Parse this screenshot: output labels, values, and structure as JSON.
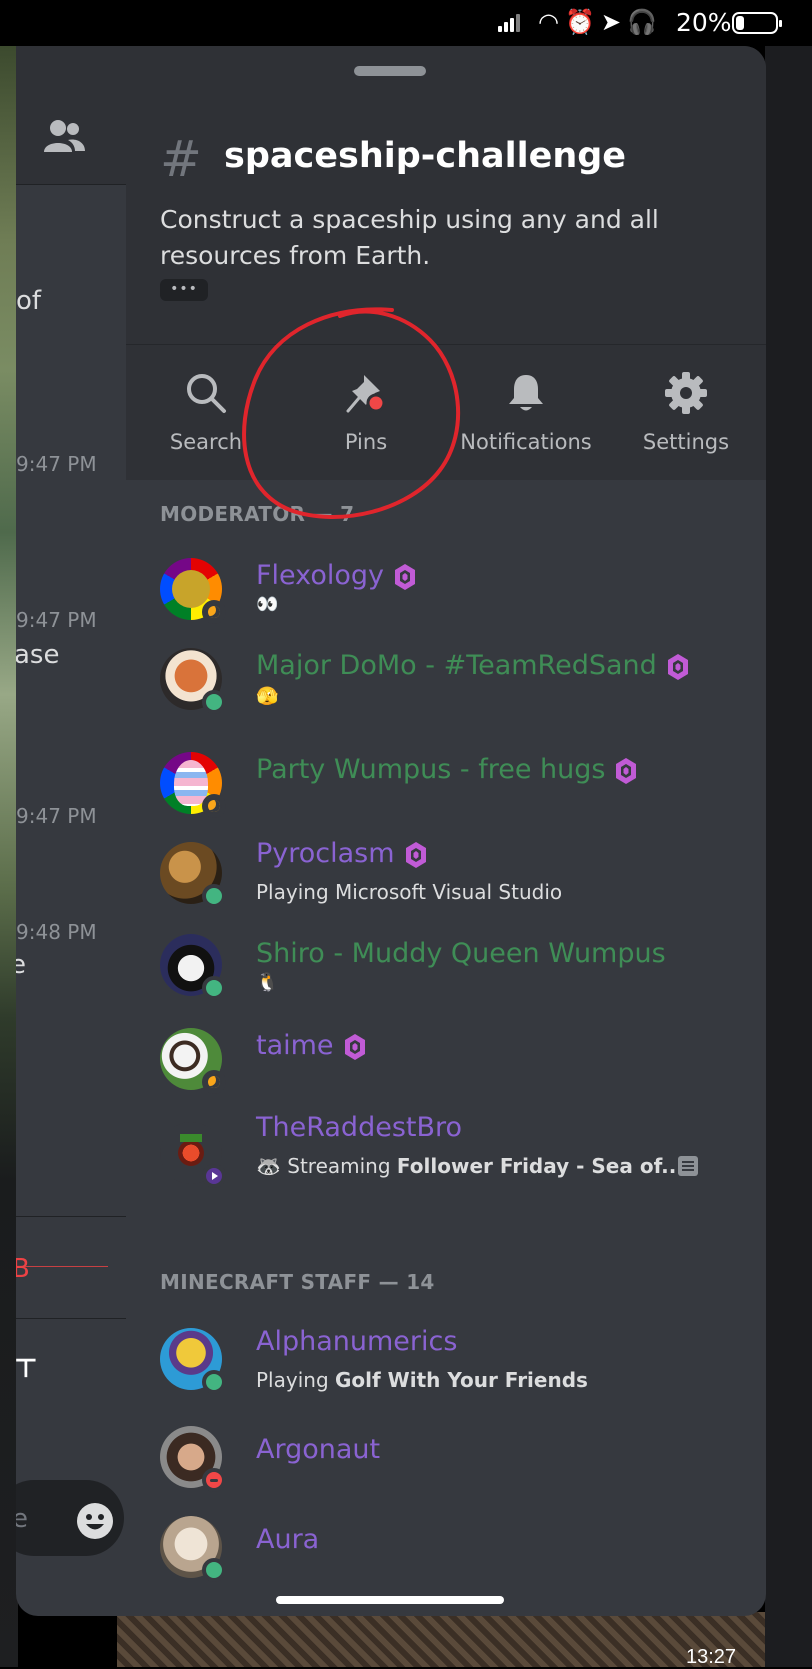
{
  "status_bar": {
    "battery_percent": "20%"
  },
  "channel": {
    "name": "spaceship-challenge",
    "hash": "#",
    "topic": "Construct a spaceship using any and all resources from Earth.",
    "more_label": "•••"
  },
  "toolbar": {
    "search": "Search",
    "pins": "Pins",
    "notifications": "Notifications",
    "settings": "Settings"
  },
  "background_chat": {
    "fragments": [
      "of",
      "ase",
      "e",
      "B",
      "e"
    ],
    "times": [
      "9:47 PM",
      "9:47 PM",
      "9:47 PM",
      "9:48 PM"
    ],
    "video_time": "13:27"
  },
  "sections": [
    {
      "header": "MODERATOR — 7",
      "members": [
        {
          "name": "Flexology",
          "color": "#8a63d2",
          "sub": "",
          "status": "idle",
          "badge": true,
          "emoji": "👀"
        },
        {
          "name": "Major DoMo - #TeamRedSand",
          "color": "#3f8d56",
          "sub": "",
          "status": "online",
          "badge": true,
          "emoji": "🫣"
        },
        {
          "name": "Party Wumpus - free hugs",
          "color": "#3f8d56",
          "sub": "",
          "status": "idle",
          "badge": true,
          "emoji": ""
        },
        {
          "name": "Pyroclasm",
          "color": "#8a63d2",
          "sub": "Playing Microsoft Visual Studio",
          "status": "online",
          "badge": true,
          "emoji": ""
        },
        {
          "name": "Shiro - Muddy Queen Wumpus",
          "color": "#3f8d56",
          "sub": "",
          "status": "online",
          "badge": false,
          "emoji": "🐧"
        },
        {
          "name": "taime",
          "color": "#8a63d2",
          "sub": "",
          "status": "idle",
          "badge": true,
          "emoji": ""
        },
        {
          "name": "TheRaddestBro",
          "color": "#8a63d2",
          "sub_prefix": "Streaming ",
          "sub_bold": "Follower Friday - Sea of...",
          "status": "stream",
          "badge": false,
          "emoji": "🦝"
        }
      ]
    },
    {
      "header": "MINECRAFT STAFF — 14",
      "members": [
        {
          "name": "Alphanumerics",
          "color": "#8a63d2",
          "sub_prefix": "Playing ",
          "sub_bold": "Golf With Your Friends",
          "status": "online"
        },
        {
          "name": "Argonaut",
          "color": "#8a63d2",
          "sub": "",
          "status": "dnd"
        },
        {
          "name": "Aura",
          "color": "#8a63d2",
          "sub": "",
          "status": "online"
        }
      ]
    }
  ],
  "colors": {
    "panel_bg": "#36393f",
    "header_bg": "#2f3136",
    "moderator_purple": "#8a63d2",
    "moderator_green": "#3f8d56",
    "annotation_red": "#e0252c"
  }
}
